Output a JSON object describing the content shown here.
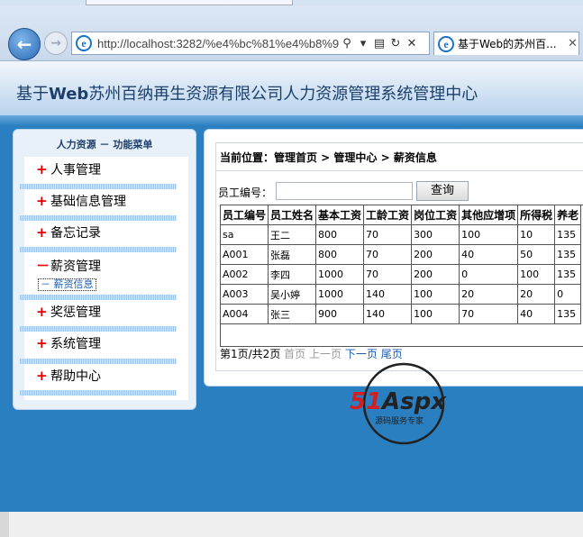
{
  "browser": {
    "url": "http://localhost:3282/%e4%bc%81%e4%b8%9",
    "tab_title": "基于Web的苏州百...",
    "icons": [
      "back-icon",
      "forward-icon",
      "ie-icon",
      "search-icon",
      "dropdown-icon",
      "compat-icon",
      "refresh-icon",
      "stop-icon",
      "close-icon"
    ]
  },
  "header": {
    "title_prefix": "基于",
    "title_bold": "Web",
    "title_suffix": "苏州百纳再生资源有限公司人力资源管理系统管理中心"
  },
  "sidebar": {
    "heading": "人力资源 － 功能菜单",
    "items": [
      {
        "sign": "+",
        "label": "人事管理"
      },
      {
        "sign": "+",
        "label": "基础信息管理"
      },
      {
        "sign": "+",
        "label": "备忘记录"
      },
      {
        "sign": "－",
        "label": "薪资管理"
      },
      {
        "sign": "+",
        "label": "奖惩管理"
      },
      {
        "sign": "+",
        "label": "系统管理"
      },
      {
        "sign": "+",
        "label": "帮助中心"
      }
    ],
    "subitem": "－ 薪资信息"
  },
  "main": {
    "breadcrumb": "当前位置：管理首页 > 管理中心 > 薪资信息",
    "search_label": "员工编号：",
    "search_value": "",
    "search_button": "查询",
    "columns": [
      "员工编号",
      "员工姓名",
      "基本工资",
      "工龄工资",
      "岗位工资",
      "其他应增项",
      "所得税",
      "养老"
    ],
    "rows": [
      [
        "sa",
        "王二",
        "800",
        "70",
        "300",
        "100",
        "10",
        "135"
      ],
      [
        "A001",
        "张磊",
        "800",
        "70",
        "200",
        "40",
        "50",
        "135"
      ],
      [
        "A002",
        "李四",
        "1000",
        "70",
        "200",
        "0",
        "100",
        "135"
      ],
      [
        "A003",
        "吴小婷",
        "1000",
        "140",
        "100",
        "20",
        "20",
        "0"
      ],
      [
        "A004",
        "张三",
        "900",
        "140",
        "100",
        "70",
        "40",
        "135"
      ]
    ],
    "pager": {
      "info": "第1页/共2页",
      "first": "首页",
      "prev": "上一页",
      "next": "下一页",
      "last": "尾页"
    }
  },
  "watermark": {
    "brand": "51Aspx",
    "tagline": "源码服务专家"
  }
}
